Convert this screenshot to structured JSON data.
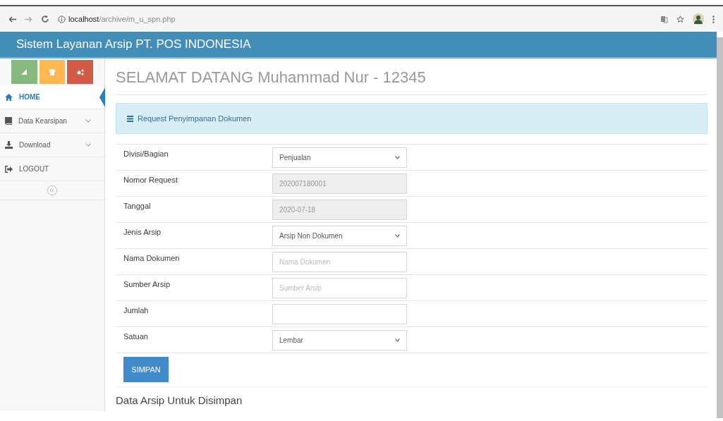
{
  "browser": {
    "url_host": "localhost",
    "url_path": "/archive/m_u_spn.php"
  },
  "header": {
    "title": "Sistem Layanan Arsip PT. POS INDONESIA"
  },
  "sidebar": {
    "items": [
      {
        "label": "HOME",
        "selected": true,
        "has_submenu": false
      },
      {
        "label": "Data Kearsipan",
        "selected": false,
        "has_submenu": true
      },
      {
        "label": "Download",
        "selected": false,
        "has_submenu": true
      },
      {
        "label": "LOGOUT",
        "selected": false,
        "has_submenu": false
      }
    ]
  },
  "welcome": "SELAMAT DATANG Muhammad Nur - 12345",
  "panel_title": "Request Penyimpanan Dokumen",
  "form": [
    {
      "label": "Divisi/Bagian",
      "kind": "select",
      "value": "Penjualan"
    },
    {
      "label": "Nomor Request",
      "kind": "readonly",
      "value": "202007180001"
    },
    {
      "label": "Tanggal",
      "kind": "readonly",
      "value": "2020-07-18"
    },
    {
      "label": "Jenis Arsip",
      "kind": "select",
      "value": "Arsip Non Dokumen"
    },
    {
      "label": "Nama Dokumen",
      "kind": "input",
      "placeholder": "Nama Dokumen"
    },
    {
      "label": "Sumber Arsip",
      "kind": "input",
      "placeholder": "Sumber Arsip"
    },
    {
      "label": "Jumlah",
      "kind": "input"
    },
    {
      "label": "Satuan",
      "kind": "select",
      "value": "Lembar"
    }
  ],
  "submit": "SIMPAN",
  "section_title": "Data Arsip Untuk Disimpan"
}
